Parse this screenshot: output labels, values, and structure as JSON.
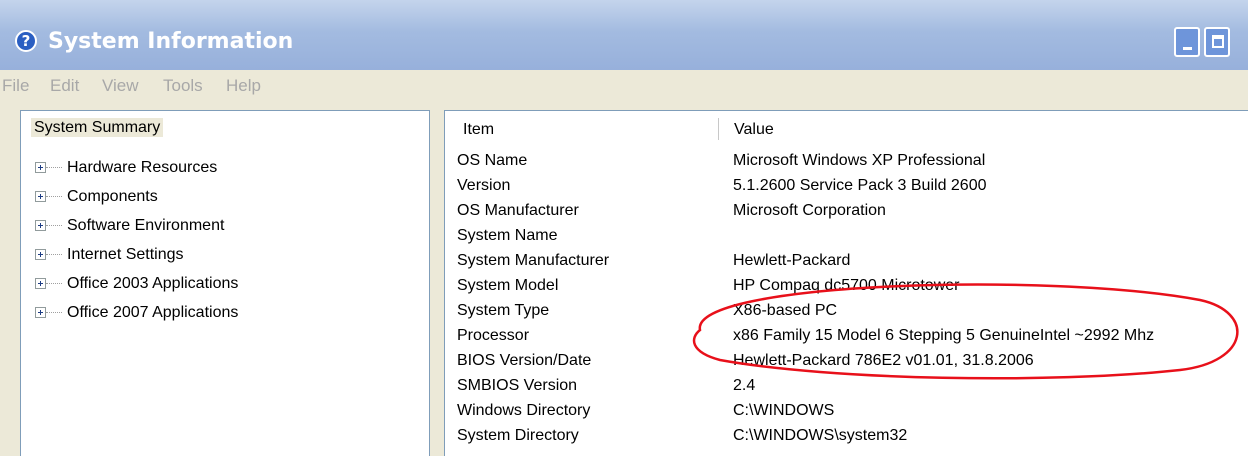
{
  "window": {
    "title": "System Information",
    "title_icon_glyph": "?",
    "icon": "help-icon"
  },
  "menu": [
    "File",
    "Edit",
    "View",
    "Tools",
    "Help"
  ],
  "tree": {
    "root": "System Summary",
    "nodes": [
      "Hardware Resources",
      "Components",
      "Software Environment",
      "Internet Settings",
      "Office 2003 Applications",
      "Office 2007 Applications"
    ]
  },
  "table": {
    "columns": [
      "Item",
      "Value"
    ],
    "rows": [
      {
        "item": "OS Name",
        "value": "Microsoft Windows XP Professional"
      },
      {
        "item": "Version",
        "value": "5.1.2600 Service Pack 3 Build 2600"
      },
      {
        "item": "OS Manufacturer",
        "value": "Microsoft Corporation"
      },
      {
        "item": "System Name",
        "value": ""
      },
      {
        "item": "System Manufacturer",
        "value": "Hewlett-Packard"
      },
      {
        "item": "System Model",
        "value": "HP Compaq dc5700 Microtower"
      },
      {
        "item": "System Type",
        "value": "X86-based PC"
      },
      {
        "item": "Processor",
        "value": "x86 Family 15 Model 6 Stepping 5 GenuineIntel ~2992 Mhz"
      },
      {
        "item": "BIOS Version/Date",
        "value": "Hewlett-Packard 786E2 v01.01, 31.8.2006"
      },
      {
        "item": "SMBIOS Version",
        "value": "2.4"
      },
      {
        "item": "Windows Directory",
        "value": "C:\\WINDOWS"
      },
      {
        "item": "System Directory",
        "value": "C:\\WINDOWS\\system32"
      }
    ]
  },
  "colors": {
    "annotation": "#E8101A",
    "titlebar": "#A3BBE0",
    "face": "#ECE9D8"
  }
}
